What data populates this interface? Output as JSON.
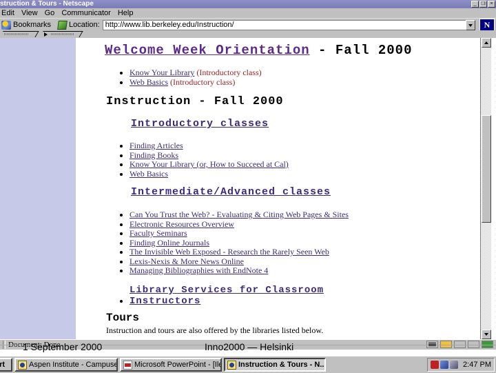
{
  "window": {
    "title": "struction & Tours - Netscape",
    "buttons": {
      "minimize": "_",
      "maximize": "❐",
      "close": "×"
    }
  },
  "menu": {
    "items": [
      {
        "label": "Edit"
      },
      {
        "label": "View"
      },
      {
        "label": "Go"
      },
      {
        "label": "Communicator"
      },
      {
        "label": "Help"
      }
    ]
  },
  "toolbar": {
    "bookmarks_label": "Bookmarks",
    "location_label": "Location:",
    "url": "http://www.lib.berkeley.edu/Instruction/",
    "logo_letter": "N"
  },
  "page": {
    "welcome_heading_link": "Welcome Week Orientation",
    "welcome_heading_rest": " - Fall 2000",
    "welcome_items": [
      {
        "link": "Know Your Library",
        "note": " (Introductory class)"
      },
      {
        "link": "Web Basics",
        "note": " (Introductory class)"
      }
    ],
    "instruction_heading": "Instruction - Fall 2000",
    "intro_subheading": "Introductory classes",
    "intro_items": [
      "Finding Articles",
      "Finding Books",
      "Know Your Library (or, How to Succeed at Cal)",
      "Web Basics"
    ],
    "advanced_subheading": "Intermediate/Advanced classes",
    "advanced_items": [
      "Can You Trust the Web? - Evaluating & Citing Web Pages & Sites",
      "Electronic Resources Overview",
      "Faculty Seminars",
      "Finding Online Journals",
      "The Invisible Web Exposed - Research the Rarely Seen Web",
      "Lexis-Nexis & More News Online",
      "Managing Bibliographies with EndNote 4"
    ],
    "library_services_link": "Library Services for Classroom Instructors",
    "tours_heading": "Tours",
    "tours_text": "Instruction and tours are also offered by the libraries listed below."
  },
  "status": {
    "text": "Document: Done"
  },
  "slide": {
    "date": "1 September 2000",
    "venue": "Inno2000 — Helsinki"
  },
  "taskbar": {
    "start_label": "art",
    "buttons": [
      {
        "label": "Aspen Institute - Campuse...",
        "icon": "netscape-icon",
        "active": false
      },
      {
        "label": "Microsoft PowerPoint - [Ile...",
        "icon": "powerpoint-icon",
        "active": false
      },
      {
        "label": "Instruction & Tours - N...",
        "icon": "netscape-icon",
        "active": true
      }
    ],
    "time": "2:47 PM"
  }
}
